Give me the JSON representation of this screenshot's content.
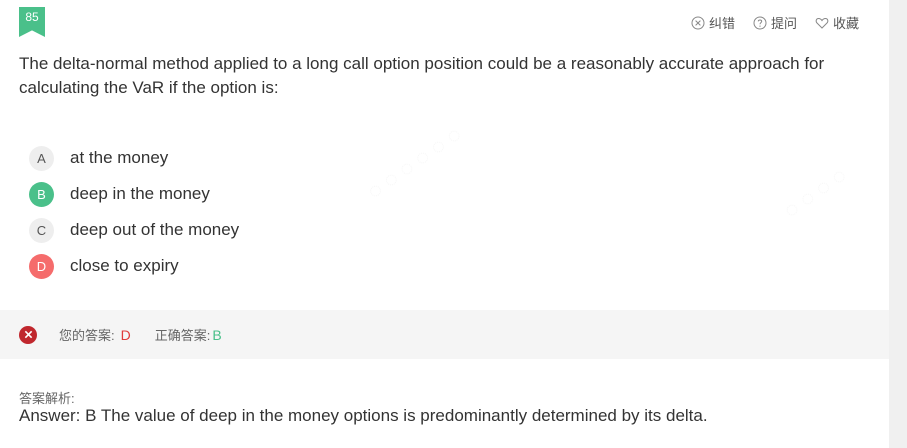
{
  "question": {
    "number": "85",
    "text": "The delta-normal method applied to a long call option position could be a reasonably accurate approach for calculating the VaR if the option is:"
  },
  "toolbar": {
    "report_label": "纠错",
    "ask_label": "提问",
    "favorite_label": "收藏"
  },
  "options": [
    {
      "letter": "A",
      "text": "at the money",
      "state": "normal"
    },
    {
      "letter": "B",
      "text": "deep in the money",
      "state": "correct"
    },
    {
      "letter": "C",
      "text": "deep out of the money",
      "state": "normal"
    },
    {
      "letter": "D",
      "text": "close to expiry",
      "state": "wrong"
    }
  ],
  "result": {
    "your_answer_label": "您的答案:",
    "your_answer": "D",
    "correct_answer_label": "正确答案:",
    "correct_answer": "B"
  },
  "analysis": {
    "title": "答案解析:",
    "text": "Answer: B The value of deep in the money options is predominantly determined by its delta."
  },
  "colors": {
    "correct": "#4ac08a",
    "wrong": "#f56c6c",
    "wrong_icon": "#c0272d"
  }
}
